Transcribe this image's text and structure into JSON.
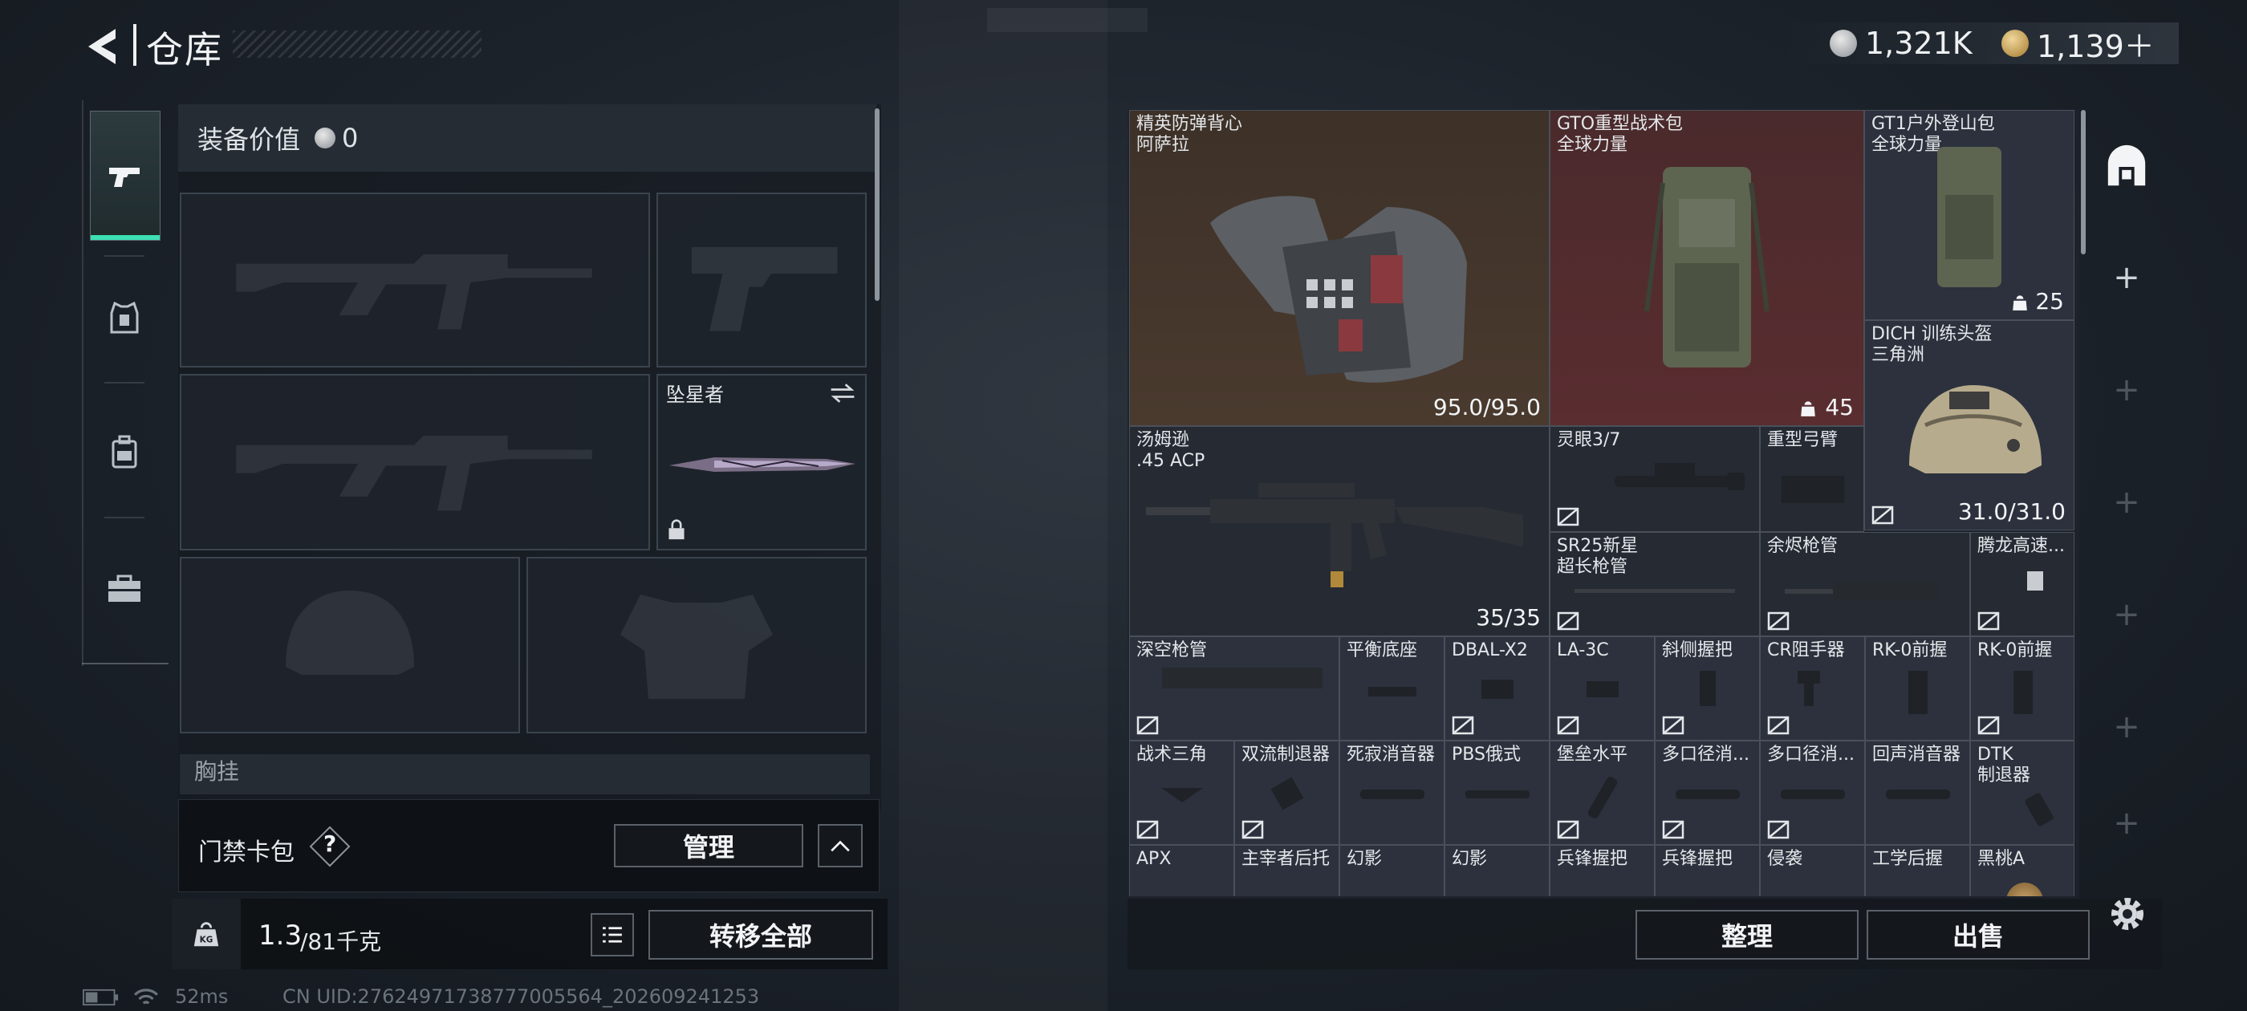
{
  "header": {
    "title": "仓库",
    "currency_silver": "1,321K",
    "currency_gold": "1,139＋"
  },
  "loadout": {
    "equip_value_label": "装备价值",
    "equip_value": "0",
    "melee_name": "坠星者",
    "chest_label": "胸挂",
    "access_card_label": "门禁卡包",
    "help_mark": "?",
    "manage_button": "管理",
    "weight_current": "1.3",
    "weight_max": "/81千克",
    "transfer_all_button": "转移全部"
  },
  "status_bar": {
    "ping": "52ms",
    "uid": "CN UID:27624971738777005564_202609241253"
  },
  "stash": {
    "items": [
      {
        "name": "精英防弹背心\n阿萨拉",
        "value": "95.0/95.0"
      },
      {
        "name": "GTO重型战术包\n全球力量",
        "count": "45"
      },
      {
        "name": "GT1户外登山包\n全球力量",
        "count": "25"
      },
      {
        "name": "DICH 训练头盔\n三角洲",
        "value": "31.0/31.0"
      },
      {
        "name": "汤姆逊\n.45 ACP",
        "value": "35/35"
      },
      {
        "name": "灵眼3/7"
      },
      {
        "name": "重型弓臂"
      },
      {
        "name": "SR25新星\n超长枪管"
      },
      {
        "name": "余烬枪管"
      },
      {
        "name": "腾龙高速..."
      },
      {
        "name": "深空枪管"
      },
      {
        "name": "平衡底座"
      },
      {
        "name": "DBAL-X2"
      },
      {
        "name": "LA-3C"
      },
      {
        "name": "斜侧握把"
      },
      {
        "name": "CR阻手器"
      },
      {
        "name": "RK-0前握"
      },
      {
        "name": "RK-0前握"
      },
      {
        "name": "战术三角"
      },
      {
        "name": "双流制退器"
      },
      {
        "name": "死寂消音器"
      },
      {
        "name": "PBS俄式"
      },
      {
        "name": "堡垒水平"
      },
      {
        "name": "多口径消..."
      },
      {
        "name": "多口径消..."
      },
      {
        "name": "回声消音器"
      },
      {
        "name": "DTK\n制退器"
      },
      {
        "name": "APX"
      },
      {
        "name": "主宰者后托"
      },
      {
        "name": "幻影"
      },
      {
        "name": "幻影"
      },
      {
        "name": "兵锋握把"
      },
      {
        "name": "兵锋握把"
      },
      {
        "name": "侵袭"
      },
      {
        "name": "工学后握"
      },
      {
        "name": "黑桃A"
      }
    ],
    "sort_button": "整理",
    "sell_button": "出售"
  },
  "colors": {
    "accent_active": "#3ee0b5",
    "vest_bg": "#4a3a2e",
    "pack_bg": "#5a2d30"
  },
  "icons": [
    "back-arrow-icon",
    "pistol-tab-icon",
    "armor-tab-icon",
    "backpack-tab-icon",
    "toolbox-tab-icon",
    "silver-coin-icon",
    "gold-coin-icon",
    "swap-icon",
    "lock-icon",
    "kg-weight-icon",
    "list-icon",
    "chevron-up-icon",
    "stash-home-icon",
    "plus-icon",
    "gear-icon",
    "battery-icon",
    "wifi-icon"
  ]
}
